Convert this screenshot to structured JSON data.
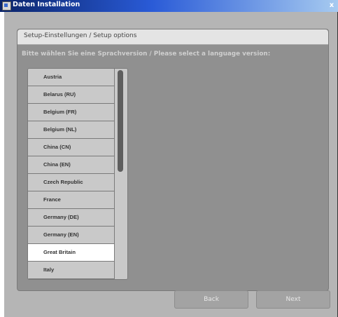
{
  "window": {
    "title": "Daten Installation",
    "icon": "installer-icon",
    "close_glyph": "x"
  },
  "panel": {
    "header": "Setup-Einstellungen / Setup options",
    "instruction": "Bitte wählen Sie eine Sprachversion / Please select a language version:"
  },
  "languages": {
    "items": [
      "Austria",
      "Belarus (RU)",
      "Belgium (FR)",
      "Belgium (NL)",
      "China (CN)",
      "China (EN)",
      "Czech Republic",
      "France",
      "Germany (DE)",
      "Germany (EN)",
      "Great Britain",
      "Italy"
    ],
    "selected": "Great Britain"
  },
  "buttons": {
    "back": "Back",
    "next": "Next"
  },
  "colors": {
    "titlebar_start": "#0a246a",
    "titlebar_end": "#a6caf0",
    "selected_row": "#ffffff"
  }
}
